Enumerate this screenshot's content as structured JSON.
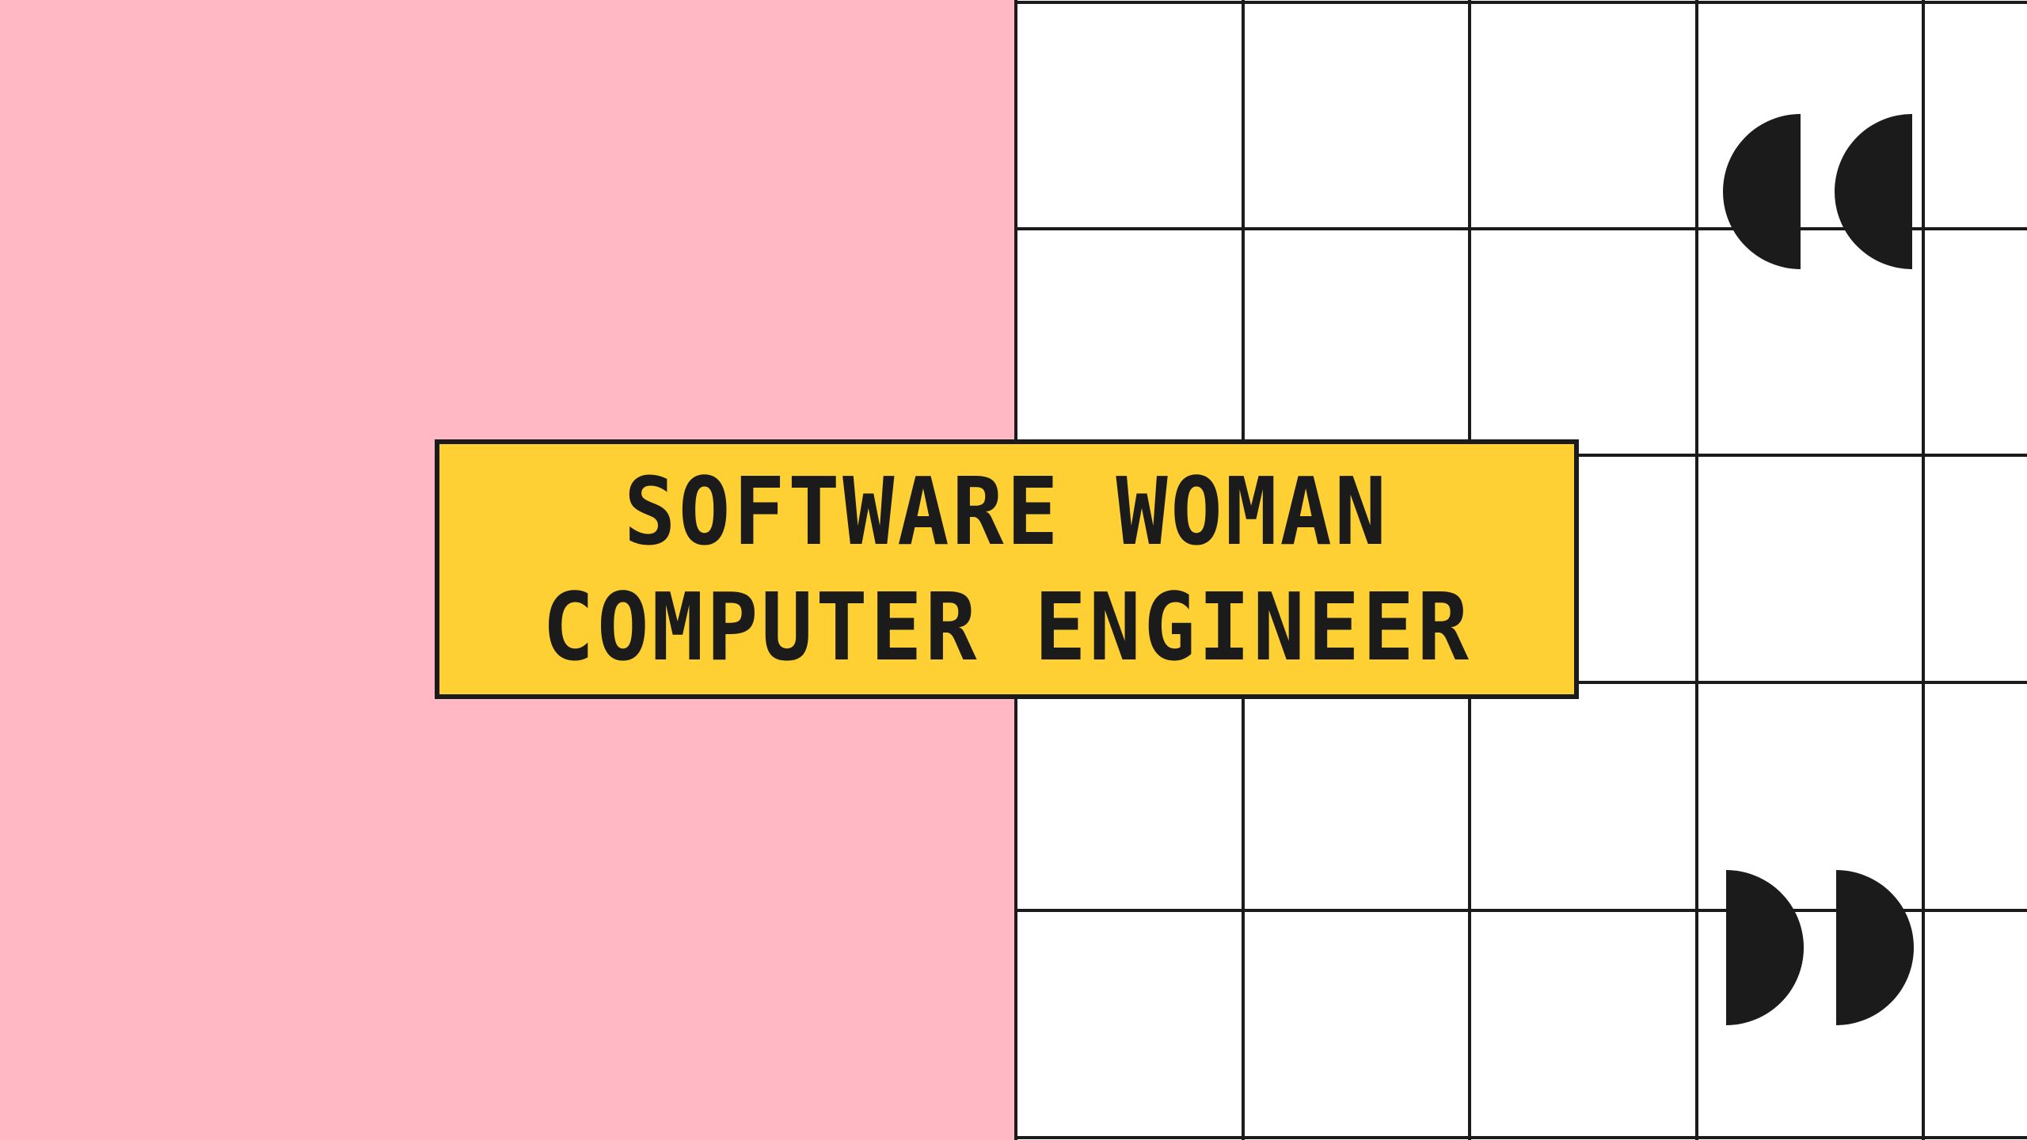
{
  "colors": {
    "pink": "#ffb8c4",
    "grid_line": "#1b1b1b",
    "grid_background": "#ffffff",
    "title_box_fill": "#fed033",
    "quote_marks": "#1b1b1b"
  },
  "title": {
    "line1": "SOFTWARE WOMAN",
    "line2": "COMPUTER ENGINEER"
  },
  "decor": {
    "open_quote_icon": "open-quote-icon",
    "close_quote_icon": "close-quote-icon"
  }
}
